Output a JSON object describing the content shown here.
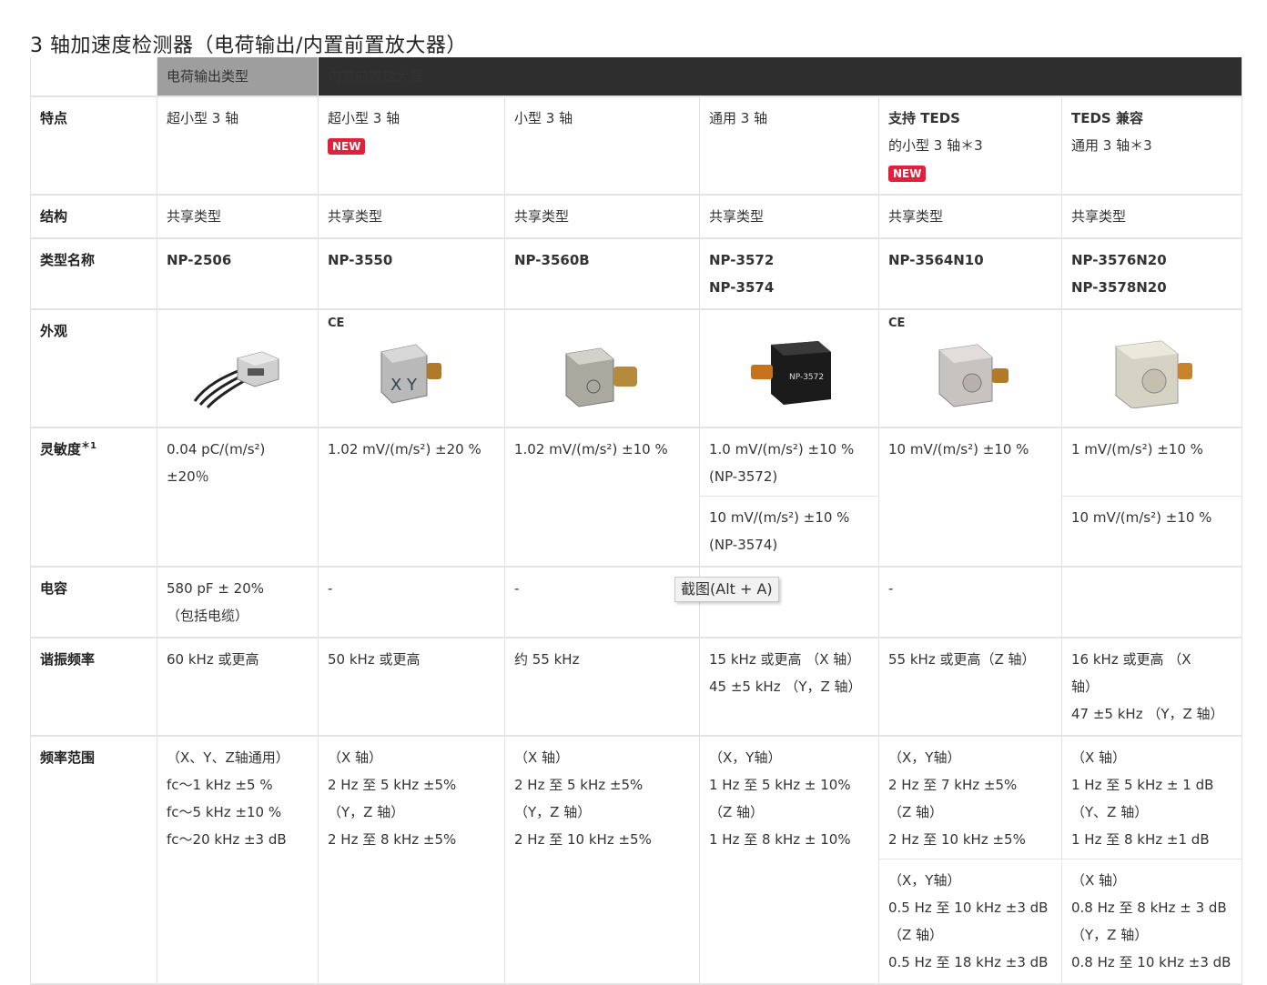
{
  "page_title": "3 轴加速度检测器（电荷输出/内置前置放大器）",
  "header": {
    "charge_output": "电荷输出类型",
    "preamp": "内置前置放大器"
  },
  "row_labels": {
    "feature": "特点",
    "structure": "结构",
    "model": "类型名称",
    "appearance": "外观",
    "sensitivity": "灵敏度",
    "sensitivity_note": "＊1",
    "capacitance": "电容",
    "resonance": "谐振频率",
    "freq_range": "频率范围"
  },
  "new_badge": "NEW",
  "ce_mark": "CE",
  "columns": [
    {
      "feature": [
        "超小型 3 轴"
      ],
      "structure": "共享类型",
      "models": [
        "NP-2506"
      ],
      "sensitivity": [
        "0.04 pC/(m/s²) ±20％"
      ],
      "capacitance": [
        "580 pF ± 20%",
        "（包括电缆）"
      ],
      "resonance": [
        "60 kHz 或更高"
      ],
      "freq_range": [
        "（X、Y、Z轴通用）",
        "fc～1 kHz ±5 %",
        "fc～5 kHz ±10 %",
        "fc～20 kHz ±3 dB"
      ]
    },
    {
      "feature": [
        "超小型 3 轴"
      ],
      "structure": "共享类型",
      "models": [
        "NP-3550"
      ],
      "sensitivity": [
        "1.02 mV/(m/s²) ±20 %"
      ],
      "capacitance": [
        "-"
      ],
      "resonance": [
        "50 kHz 或更高"
      ],
      "freq_range": [
        "（X 轴）",
        "2 Hz 至 5 kHz ±5%",
        "（Y，Z 轴）",
        "2 Hz 至 8 kHz ±5%"
      ]
    },
    {
      "feature": [
        "小型 3 轴"
      ],
      "structure": "共享类型",
      "models": [
        "NP-3560B"
      ],
      "sensitivity": [
        "1.02 mV/(m/s²) ±10 %"
      ],
      "capacitance": [
        "-"
      ],
      "resonance": [
        "约 55 kHz"
      ],
      "freq_range": [
        "（X 轴）",
        "2 Hz 至 5 kHz ±5%",
        "（Y，Z 轴）",
        "2 Hz 至 10 kHz ±5%"
      ]
    },
    {
      "feature": [
        "通用 3 轴"
      ],
      "structure": "共享类型",
      "models": [
        "NP-3572",
        "NP-3574"
      ],
      "sensitivity": [
        "1.0 mV/(m/s²) ±10 %",
        "(NP-3572)"
      ],
      "sensitivity_b": [
        "10 mV/(m/s²) ±10 %",
        "(NP-3574)"
      ],
      "capacitance": [
        "-"
      ],
      "resonance": [
        "15 kHz 或更高 （X 轴）",
        "45 ±5 kHz （Y，Z 轴）"
      ],
      "freq_range": [
        "（X，Y轴）",
        "1 Hz 至 5 kHz ± 10%",
        "（Z 轴）",
        "1 Hz 至 8 kHz ± 10%"
      ]
    },
    {
      "feature_bold": "支持 TEDS",
      "feature": [
        "的小型 3 轴＊3"
      ],
      "structure": "共享类型",
      "models": [
        "NP-3564N10"
      ],
      "sensitivity": [
        "10 mV/(m/s²) ±10 %"
      ],
      "capacitance": [
        "-"
      ],
      "resonance": [
        "55 kHz 或更高（Z 轴）"
      ],
      "freq_range": [
        "（X，Y轴）",
        "2 Hz 至 7 kHz ±5%",
        "（Z 轴）",
        "2 Hz 至 10 kHz ±5%"
      ],
      "freq_range_b": [
        "（X，Y轴）",
        "0.5 Hz 至 10 kHz ±3 dB",
        "（Z 轴）",
        "0.5 Hz 至 18 kHz ±3 dB"
      ]
    },
    {
      "feature_bold": "TEDS 兼容",
      "feature": [
        "通用 3 轴＊3"
      ],
      "structure": "共享类型",
      "models": [
        "NP-3576N20",
        "NP-3578N20"
      ],
      "sensitivity": [
        "1 mV/(m/s²) ±10 %"
      ],
      "sensitivity_b": [
        "10 mV/(m/s²) ±10 %"
      ],
      "capacitance": [
        ""
      ],
      "resonance": [
        "16 kHz 或更高 （X",
        "轴）",
        "47 ±5 kHz （Y，Z 轴）"
      ],
      "freq_range": [
        "（X 轴）",
        "1 Hz 至 5 kHz ± 1 dB",
        "（Y、Z 轴）",
        "1 Hz 至 8 kHz ±1 dB"
      ],
      "freq_range_b": [
        "（X 轴）",
        "0.8 Hz 至 8 kHz ± 3 dB",
        "（Y，Z 轴）",
        "0.8 Hz 至 10 kHz ±3 dB"
      ]
    }
  ],
  "tooltip": "截图(Alt + A)"
}
